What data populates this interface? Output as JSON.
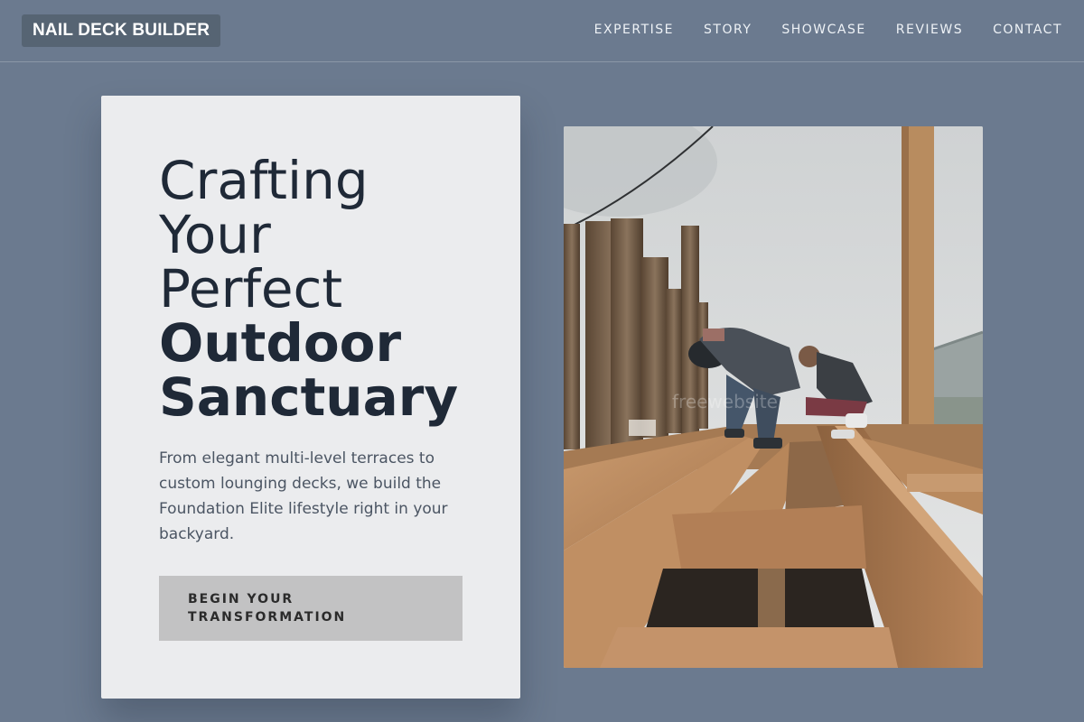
{
  "brand": {
    "name": "NAIL DECK BUILDER"
  },
  "nav": {
    "items": [
      {
        "label": "EXPERTISE"
      },
      {
        "label": "STORY"
      },
      {
        "label": "SHOWCASE"
      },
      {
        "label": "REVIEWS"
      },
      {
        "label": "CONTACT"
      }
    ]
  },
  "hero": {
    "headline_lines": [
      "Crafting",
      "Your",
      "Perfect"
    ],
    "headline_bold_lines": [
      "Outdoor",
      "Sanctuary"
    ],
    "description": "From elegant multi-level terraces to custom lounging decks, we build the Foundation Elite lifestyle right in your backyard.",
    "cta_label": "BEGIN YOUR TRANSFORMATION"
  },
  "photo": {
    "subject": "workers-building-wooden-deck",
    "watermark": "freewebsite"
  },
  "colors": {
    "background": "#6b7a8f",
    "card": "#ebecee",
    "headline": "#1f2937",
    "cta_background": "#c2c2c3",
    "logo_background": "#566473"
  }
}
